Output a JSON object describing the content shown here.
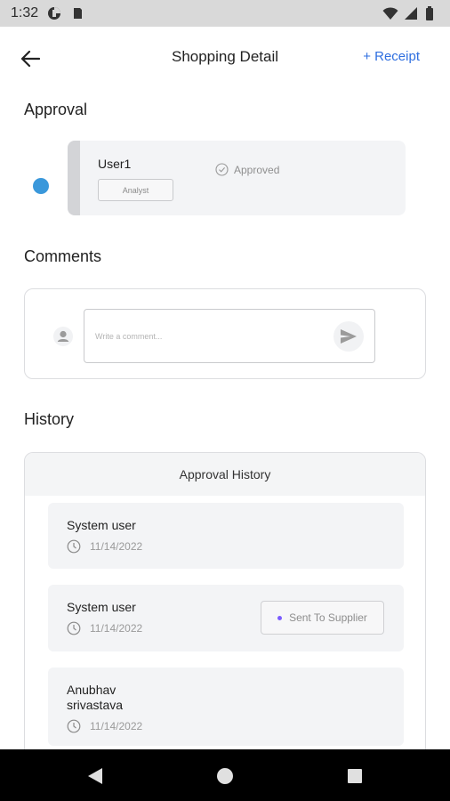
{
  "status_bar": {
    "time": "1:32"
  },
  "header": {
    "title": "Shopping Detail",
    "receipt_label": "+ Receipt"
  },
  "sections": {
    "approval": "Approval",
    "comments": "Comments",
    "history": "History"
  },
  "approval": {
    "name": "User1",
    "role": "Analyst",
    "status": "Approved",
    "dot_color": "#3a98db"
  },
  "comments": {
    "placeholder": "Write a comment..."
  },
  "history": {
    "header": "Approval History",
    "items": [
      {
        "name": "System user",
        "date": "11/14/2022"
      },
      {
        "name": "System user",
        "date": "11/14/2022",
        "status": "Sent To Supplier"
      },
      {
        "name": "Anubhav srivastava",
        "date": "11/14/2022"
      }
    ]
  },
  "colors": {
    "accent": "#2f6fe0",
    "status_dot": "#7b5cff"
  }
}
